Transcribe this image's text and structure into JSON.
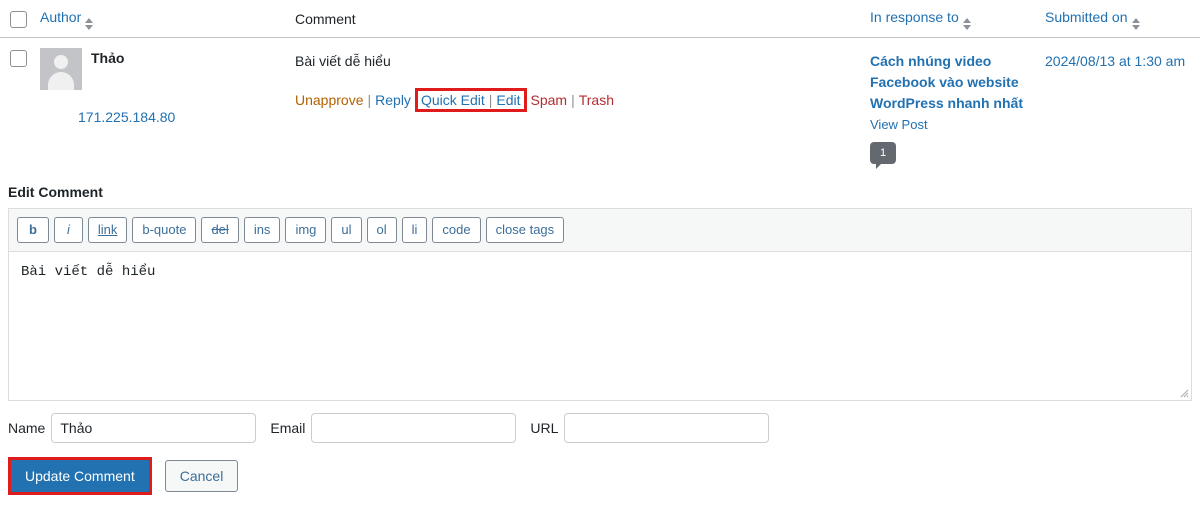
{
  "table": {
    "headers": {
      "author": "Author",
      "comment": "Comment",
      "in_response_to": "In response to",
      "submitted_on": "Submitted on"
    },
    "row": {
      "author_name": "Thảo",
      "author_ip": "171.225.184.80",
      "comment_text": "Bài viết dễ hiểu",
      "actions": {
        "unapprove": "Unapprove",
        "reply": "Reply",
        "quick_edit": "Quick Edit",
        "edit": "Edit",
        "spam": "Spam",
        "trash": "Trash",
        "separator": "|"
      },
      "response_post": "Cách nhúng video Facebook vào website WordPress nhanh nhất",
      "view_post": "View Post",
      "comment_count": "1",
      "submitted_on": "2024/08/13 at 1:30 am"
    }
  },
  "editor": {
    "section_label": "Edit Comment",
    "toolbar_buttons": [
      "b",
      "i",
      "link",
      "b-quote",
      "del",
      "ins",
      "img",
      "ul",
      "ol",
      "li",
      "code",
      "close tags"
    ],
    "content": "Bài viết dễ hiểu"
  },
  "fields": {
    "name_label": "Name",
    "name_value": "Thảo",
    "name_placeholder": "",
    "email_label": "Email",
    "email_value": "",
    "email_placeholder": "",
    "url_label": "URL",
    "url_value": "",
    "url_placeholder": ""
  },
  "buttons": {
    "update": "Update Comment",
    "cancel": "Cancel"
  },
  "colors": {
    "link_blue": "#2271b1",
    "unapprove_orange": "#b26200",
    "spam_red": "#b32d2e",
    "highlight_red": "#e01b1b",
    "primary_button": "#2271b1",
    "badge_gray": "#646970"
  }
}
